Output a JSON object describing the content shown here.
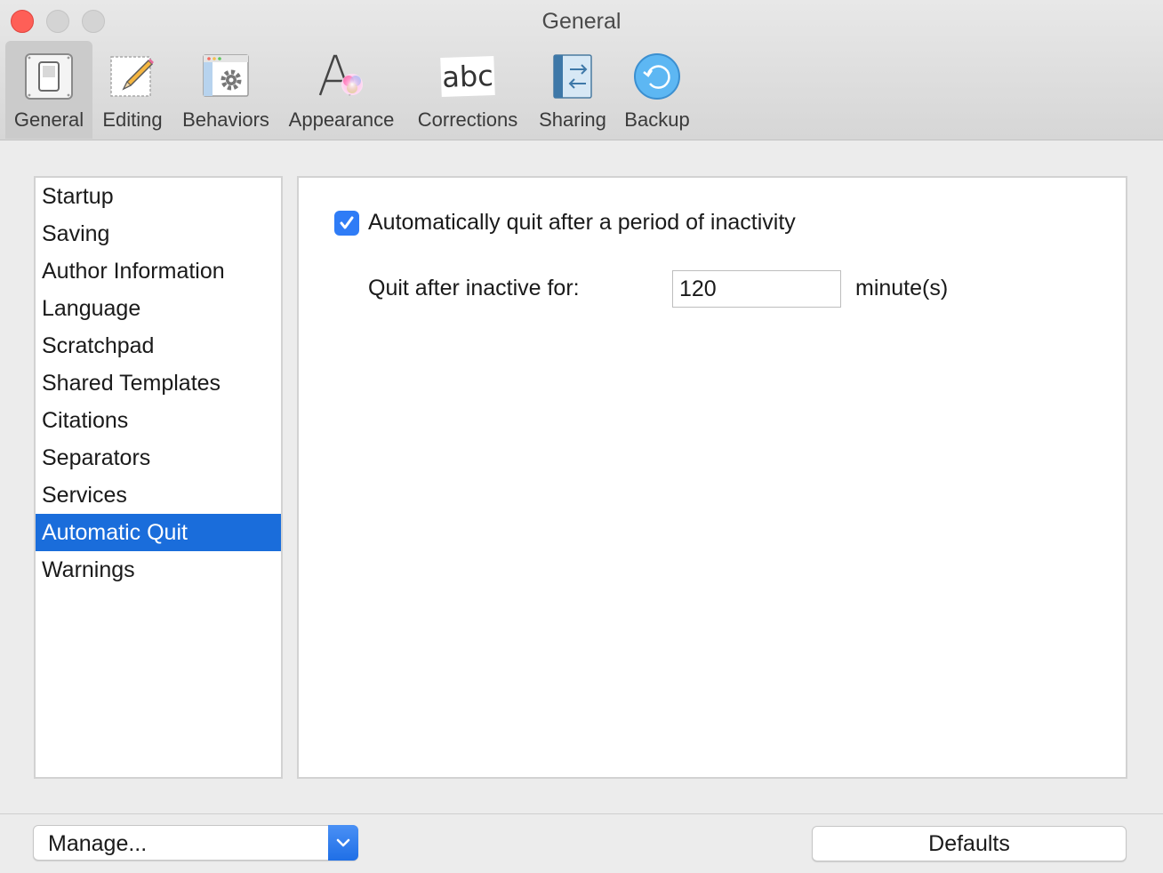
{
  "window": {
    "title": "General"
  },
  "toolbar": {
    "items": [
      {
        "label": "General",
        "icon": "general-switch-icon",
        "selected": true
      },
      {
        "label": "Editing",
        "icon": "pencil-icon"
      },
      {
        "label": "Behaviors",
        "icon": "gear-window-icon"
      },
      {
        "label": "Appearance",
        "icon": "font-color-icon"
      },
      {
        "label": "Corrections",
        "icon": "abc-icon"
      },
      {
        "label": "Sharing",
        "icon": "sharing-arrows-icon"
      },
      {
        "label": "Backup",
        "icon": "backup-restore-icon"
      }
    ],
    "corrections_glyph": "abc"
  },
  "sidebar": {
    "items": [
      {
        "label": "Startup"
      },
      {
        "label": "Saving"
      },
      {
        "label": "Author Information"
      },
      {
        "label": "Language"
      },
      {
        "label": "Scratchpad"
      },
      {
        "label": "Shared Templates"
      },
      {
        "label": "Citations"
      },
      {
        "label": "Separators"
      },
      {
        "label": "Services"
      },
      {
        "label": "Automatic Quit",
        "selected": true
      },
      {
        "label": "Warnings"
      }
    ]
  },
  "main": {
    "auto_quit_checkbox_label": "Automatically quit after a period of inactivity",
    "auto_quit_checked": true,
    "quit_after_label": "Quit after inactive for:",
    "quit_after_value": "120",
    "unit_label": "minute(s)"
  },
  "footer": {
    "manage_label": "Manage...",
    "defaults_label": "Defaults"
  },
  "colors": {
    "accent": "#1a6ddb",
    "checkbox": "#2f7cf6",
    "close_button": "#fe5f57"
  }
}
